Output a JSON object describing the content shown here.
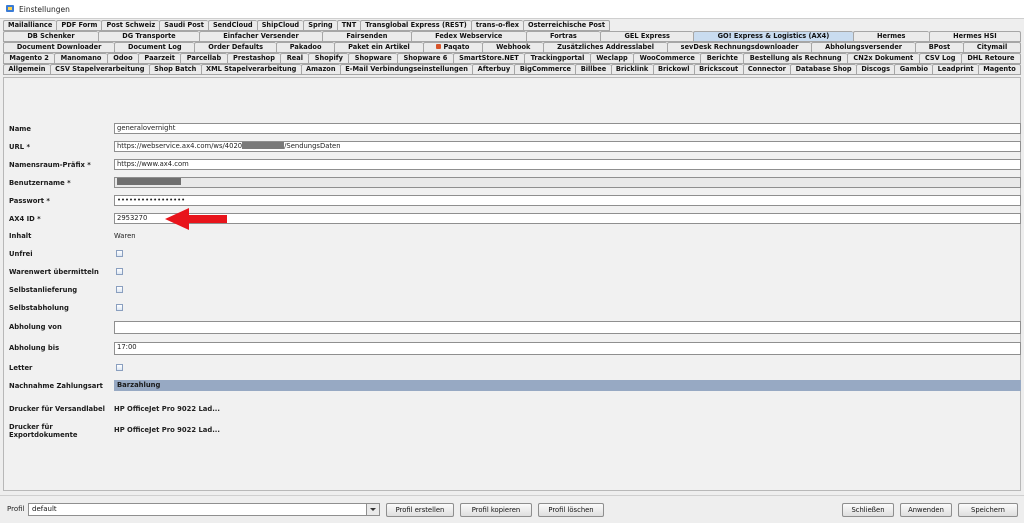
{
  "window": {
    "title": "Einstellungen"
  },
  "tabs": {
    "row1": [
      "Mailalliance",
      "PDF Form",
      "Post Schweiz",
      "Saudi Post",
      "SendCloud",
      "ShipCloud",
      "Spring",
      "TNT",
      "Transglobal Express (REST)",
      "trans-o-flex",
      "Österreichische Post"
    ],
    "row2": [
      "DB Schenker",
      "DG Transporte",
      "Einfacher Versender",
      "Fairsenden",
      "Fedex Webservice",
      "Fortras",
      "GEL Express",
      "GO! Express & Logistics (AX4)",
      "Hermes",
      "Hermes HSI"
    ],
    "row3": [
      "Document Downloader",
      "Document Log",
      "Order Defaults",
      "Pakadoo",
      "Paket ein Artikel",
      "Paqato",
      "Webhook",
      "Zusätzliches Addresslabel",
      "sevDesk Rechnungsdownloader",
      "Abholungsversender",
      "BPost",
      "Citymail"
    ],
    "row4": [
      "Magento 2",
      "Manomano",
      "Odoo",
      "Paarzeit",
      "Parcellab",
      "Prestashop",
      "Real",
      "Shopify",
      "Shopware",
      "Shopware 6",
      "SmartStore.NET",
      "Trackingportal",
      "Weclapp",
      "WooCommerce",
      "Berichte",
      "Bestellung als Rechnung",
      "CN2x Dokument",
      "CSV Log",
      "DHL Retoure"
    ],
    "row5": [
      "Allgemein",
      "CSV Stapelverarbeitung",
      "Shop Batch",
      "XML Stapelverarbeitung",
      "Amazon",
      "E-Mail Verbindungseinstellungen",
      "Afterbuy",
      "BigCommerce",
      "Billbee",
      "Bricklink",
      "Brickowl",
      "Brickscout",
      "Connector",
      "Database Shop",
      "Discogs",
      "Gambio",
      "Leadprint",
      "Magento"
    ],
    "active": "GO! Express & Logistics (AX4)"
  },
  "form": {
    "name": {
      "label": "Name",
      "value": "generalovernight"
    },
    "url": {
      "label": "URL *",
      "value_prefix": "https://webservice.ax4.com/ws/4020",
      "value_suffix": "/SendungsDaten"
    },
    "namespace": {
      "label": "Namensraum-Präfix *",
      "value": "https://www.ax4.com"
    },
    "username": {
      "label": "Benutzername *"
    },
    "password": {
      "label": "Passwort *",
      "value": "•••••••••••••••••"
    },
    "ax4id": {
      "label": "AX4 ID *",
      "value": "2953270"
    },
    "inhalt": {
      "label": "Inhalt",
      "value": "Waren"
    },
    "unfrei": {
      "label": "Unfrei"
    },
    "warenwert": {
      "label": "Warenwert übermitteln"
    },
    "selbstanlieferung": {
      "label": "Selbstanlieferung"
    },
    "selbstabholung": {
      "label": "Selbstabholung"
    },
    "abholung_von": {
      "label": "Abholung von",
      "value": ""
    },
    "abholung_bis": {
      "label": "Abholung bis",
      "value": "17:00"
    },
    "letter": {
      "label": "Letter"
    },
    "nachnahme": {
      "label": "Nachnahme Zahlungsart",
      "value": "Barzahlung"
    },
    "drucker_versand": {
      "label": "Drucker für Versandlabel",
      "value": "HP OfficeJet Pro 9022 Lad..."
    },
    "drucker_export": {
      "label_line1": "Drucker für",
      "label_line2": "Exportdokumente",
      "value": "HP OfficeJet Pro 9022 Lad..."
    }
  },
  "annotation": {
    "color": "#e8141b"
  },
  "bottom": {
    "profile_label": "Profil",
    "profile_value": "default",
    "create": "Profil erstellen",
    "copy": "Profil kopieren",
    "delete": "Profil löschen",
    "close": "Schließen",
    "apply": "Anwenden",
    "save": "Speichern"
  }
}
